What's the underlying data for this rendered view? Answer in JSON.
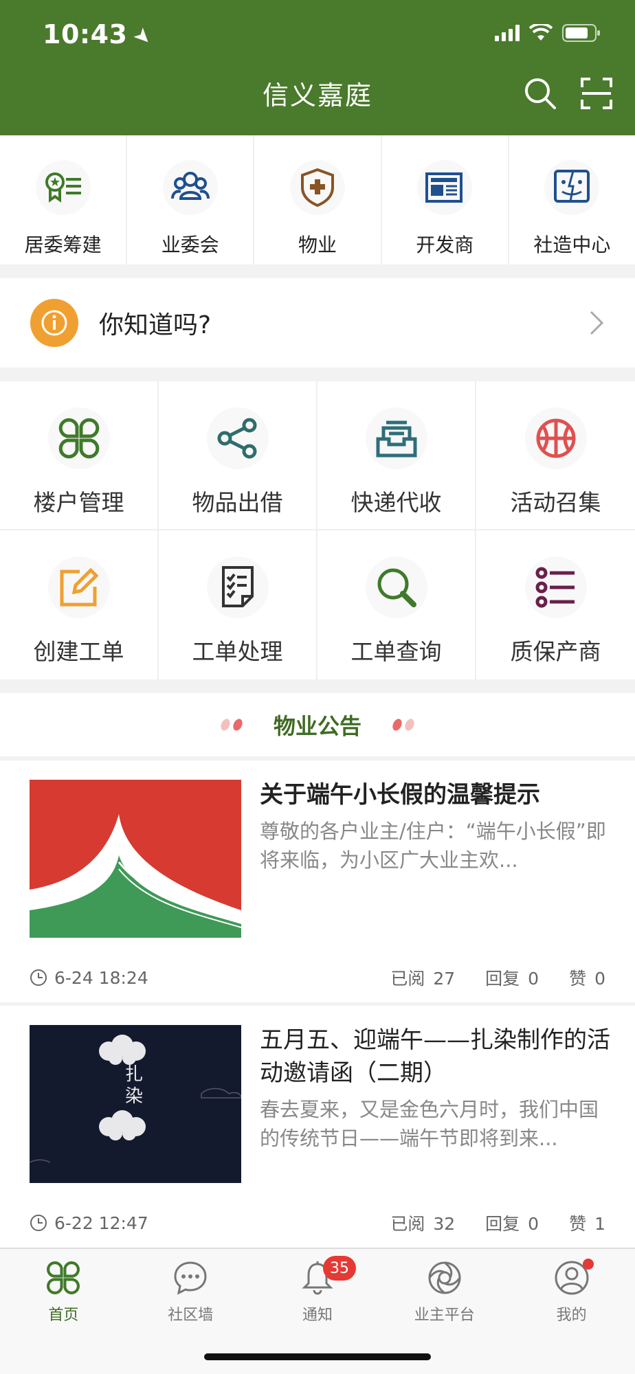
{
  "status_bar": {
    "time": "10:43"
  },
  "header": {
    "title": "信义嘉庭"
  },
  "categories": [
    {
      "label": "居委筹建",
      "icon": "award-list-icon"
    },
    {
      "label": "业委会",
      "icon": "users-icon"
    },
    {
      "label": "物业",
      "icon": "shield-plus-icon"
    },
    {
      "label": "开发商",
      "icon": "newspaper-icon"
    },
    {
      "label": "社造中心",
      "icon": "face-box-icon"
    }
  ],
  "tip": {
    "text": "你知道吗?"
  },
  "services": [
    {
      "label": "楼户管理",
      "icon": "grid-icon"
    },
    {
      "label": "物品出借",
      "icon": "share-icon"
    },
    {
      "label": "快递代收",
      "icon": "inbox-icon"
    },
    {
      "label": "活动召集",
      "icon": "basketball-icon"
    },
    {
      "label": "创建工单",
      "icon": "edit-icon"
    },
    {
      "label": "工单处理",
      "icon": "checklist-icon"
    },
    {
      "label": "工单查询",
      "icon": "search-icon"
    },
    {
      "label": "质保产商",
      "icon": "list-icon"
    }
  ],
  "notice": {
    "title": "物业公告"
  },
  "articles": [
    {
      "title": "关于端午小长假的温馨提示",
      "desc": "尊敬的各户业主/住户：“端午小长假”即将来临，为小区广大业主欢...",
      "time": "6-24 18:24",
      "read_label": "已阅",
      "read": "27",
      "reply_label": "回复",
      "reply": "0",
      "like_label": "赞",
      "like": "0"
    },
    {
      "title": "五月五、迎端午——扎染制作的活动邀请函（二期）",
      "desc": "春去夏来，又是金色六月时，我们中国的传统节日——端午节即将到来...",
      "image_text_1": "扎",
      "image_text_2": "染",
      "time": "6-22 12:47",
      "read_label": "已阅",
      "read": "32",
      "reply_label": "回复",
      "reply": "0",
      "like_label": "赞",
      "like": "1"
    }
  ],
  "tabs": [
    {
      "label": "首页",
      "icon": "home-grid-icon",
      "active": true
    },
    {
      "label": "社区墙",
      "icon": "chat-bubble-icon"
    },
    {
      "label": "通知",
      "icon": "bell-icon",
      "badge": "35"
    },
    {
      "label": "业主平台",
      "icon": "aperture-icon"
    },
    {
      "label": "我的",
      "icon": "user-circle-icon",
      "dot": true
    }
  ],
  "colors": {
    "header_bg": "#4a7a2c",
    "accent_green": "#3f6b24",
    "badge_red": "#e53935",
    "tip_orange": "#f0a030"
  }
}
